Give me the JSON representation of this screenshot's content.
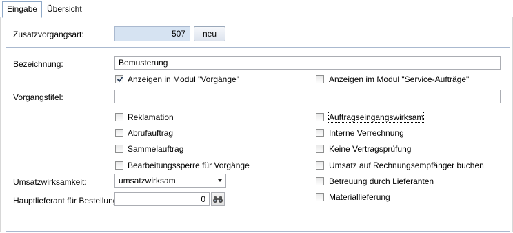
{
  "tabs": [
    {
      "label": "Eingabe",
      "active": true
    },
    {
      "label": "Übersicht",
      "active": false
    }
  ],
  "zusatz": {
    "label": "Zusatzvorgangsart:",
    "value": "507",
    "button": "neu"
  },
  "bezeichnung": {
    "label": "Bezeichnung:",
    "value": "Bemusterung"
  },
  "anzeigen": {
    "vorgaenge": {
      "label": "Anzeigen in Modul \"Vorgänge\"",
      "checked": true
    },
    "service": {
      "label": "Anzeigen im Modul \"Service-Aufträge\"",
      "checked": false
    }
  },
  "vorgangstitel": {
    "label": "Vorgangstitel:",
    "value": ""
  },
  "checkboxes_left": [
    {
      "label": "Reklamation",
      "checked": false
    },
    {
      "label": "Abrufauftrag",
      "checked": false
    },
    {
      "label": "Sammelauftrag",
      "checked": false
    },
    {
      "label": "Bearbeitungssperre für Vorgänge",
      "checked": false
    }
  ],
  "checkboxes_right": [
    {
      "label": "Auftragseingangswirksam",
      "checked": false
    },
    {
      "label": "Interne Verrechnung",
      "checked": false
    },
    {
      "label": "Keine Vertragsprüfung",
      "checked": false
    },
    {
      "label": "Umsatz auf Rechnungsempfänger buchen",
      "checked": false
    },
    {
      "label": "Betreuung durch Lieferanten",
      "checked": false
    },
    {
      "label": "Materiallieferung",
      "checked": false
    }
  ],
  "umsatz": {
    "label": "Umsatzwirksamkeit:",
    "value": "umsatzwirksam"
  },
  "hauptlieferant": {
    "label": "Hauptlieferant für Bestellung:",
    "value": "0",
    "icon": "binoculars-icon"
  },
  "colors": {
    "tab_border": "#8fa9c8",
    "readonly_field": "#d6e3f2",
    "group_border": "#aab9cf"
  }
}
